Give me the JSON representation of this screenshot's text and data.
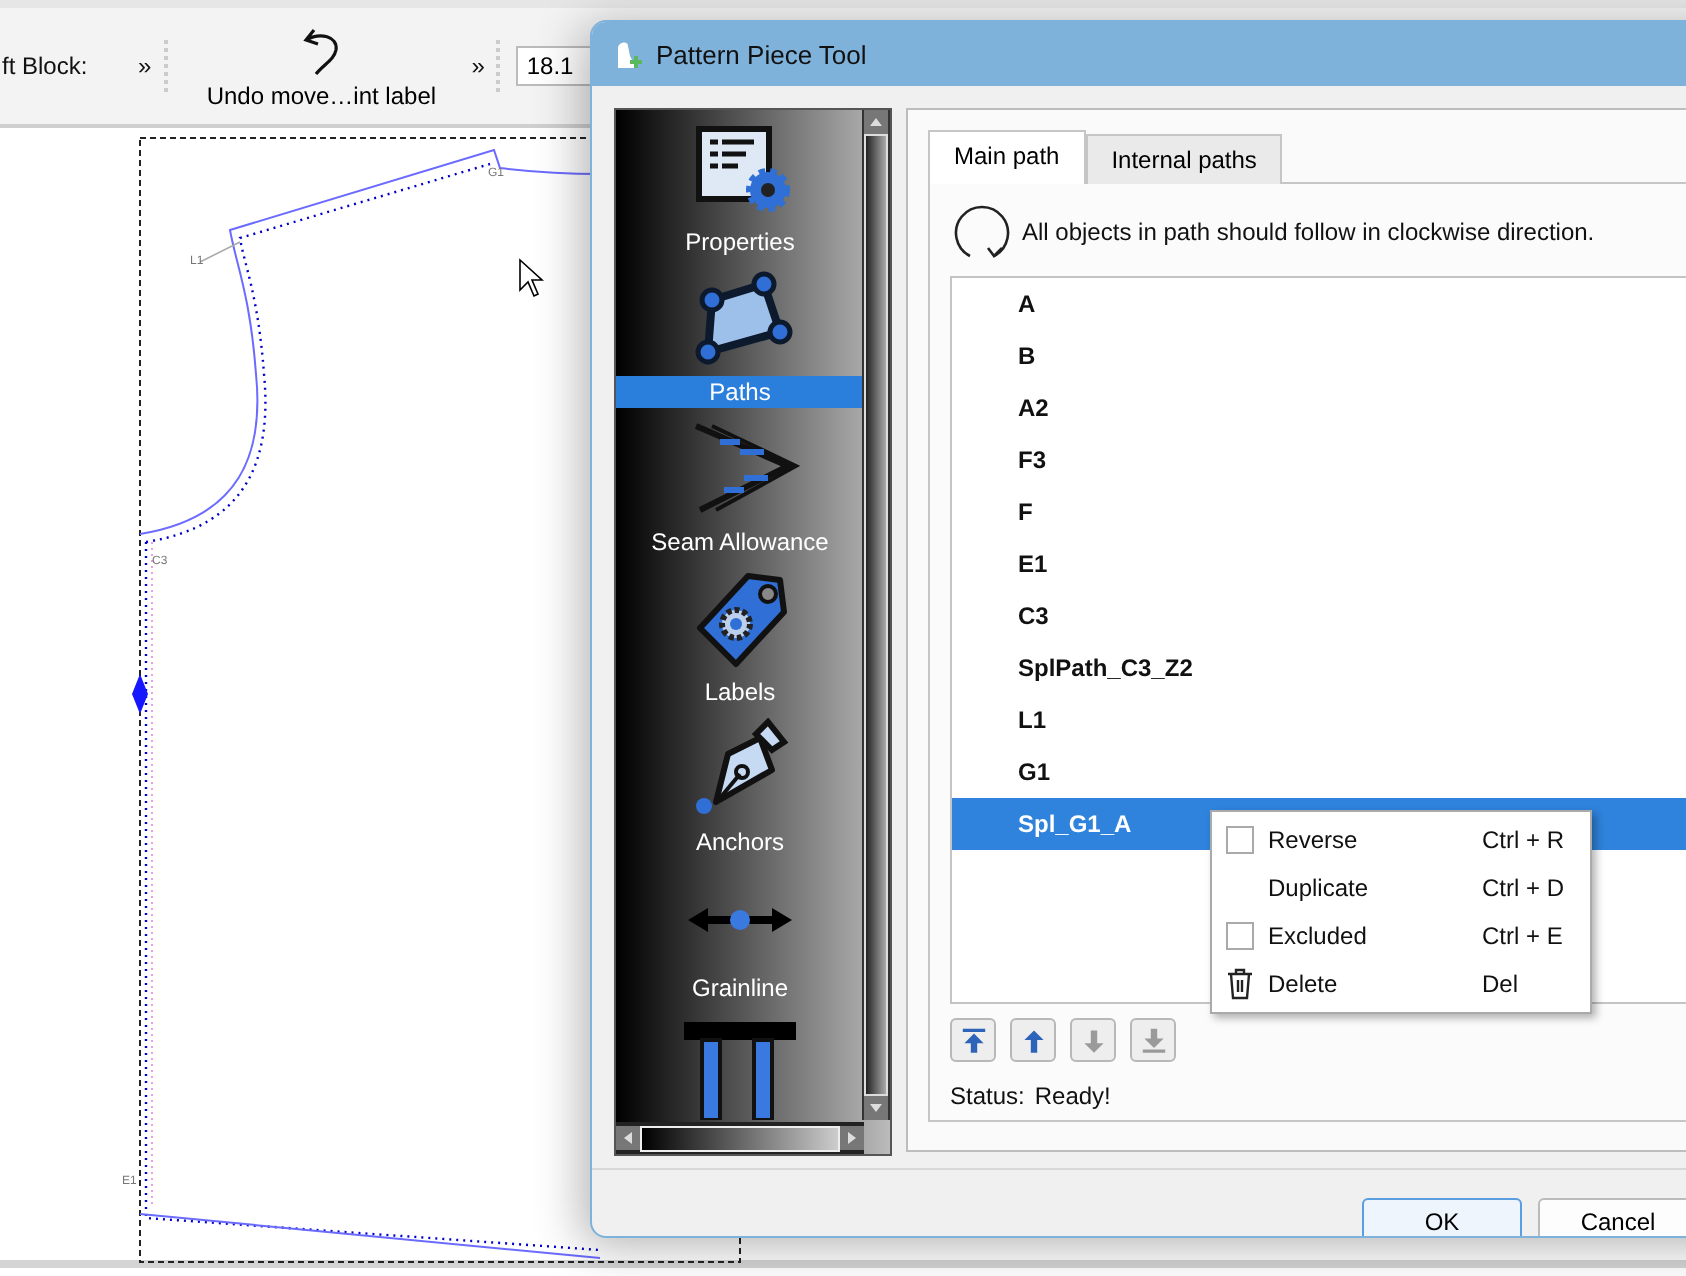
{
  "toolbar": {
    "block_label": "ft Block:",
    "chevrons": [
      "»",
      "»"
    ],
    "undo_label": "Undo move…int label",
    "field_value": "18.1"
  },
  "canvas": {
    "point_labels": [
      {
        "text": "G1",
        "kind": "top"
      },
      {
        "text": "L1",
        "kind": "shoulder"
      },
      {
        "text": "C3",
        "kind": "armhole"
      },
      {
        "text": "E1",
        "kind": "hem"
      }
    ]
  },
  "dialog": {
    "title": "Pattern Piece Tool",
    "sections": [
      {
        "label": "Properties",
        "kind": "properties",
        "selected": false
      },
      {
        "label": "Paths",
        "kind": "paths",
        "selected": true
      },
      {
        "label": "Seam Allowance",
        "kind": "seam",
        "selected": false
      },
      {
        "label": "Labels",
        "kind": "labels",
        "selected": false
      },
      {
        "label": "Anchors",
        "kind": "anchors",
        "selected": false
      },
      {
        "label": "Grainline",
        "kind": "grainline",
        "selected": false
      },
      {
        "kind": "table"
      }
    ],
    "tabs": [
      {
        "label": "Main path",
        "selected": true
      },
      {
        "label": "Internal paths",
        "selected": false
      }
    ],
    "hint": "All objects in path should follow in clockwise direction.",
    "path_items": [
      {
        "name": "A",
        "selected": false
      },
      {
        "name": "B",
        "selected": false
      },
      {
        "name": "A2",
        "selected": false
      },
      {
        "name": "F3",
        "selected": false
      },
      {
        "name": "F",
        "selected": false
      },
      {
        "name": "E1",
        "selected": false
      },
      {
        "name": "C3",
        "selected": false
      },
      {
        "name": "SplPath_C3_Z2",
        "selected": false
      },
      {
        "name": "L1",
        "selected": false
      },
      {
        "name": "G1",
        "selected": false
      },
      {
        "name": "Spl_G1_A",
        "selected": true
      }
    ],
    "context_menu": [
      {
        "label": "Reverse",
        "shortcut": "Ctrl + R",
        "kind": "checkbox",
        "checked": false
      },
      {
        "label": "Duplicate",
        "shortcut": "Ctrl + D",
        "kind": "plain"
      },
      {
        "label": "Excluded",
        "shortcut": "Ctrl + E",
        "kind": "checkbox",
        "checked": false
      },
      {
        "label": "Delete",
        "shortcut": "Del",
        "kind": "delete"
      }
    ],
    "move_buttons": [
      {
        "kind": "top",
        "disabled": false
      },
      {
        "kind": "up",
        "disabled": false
      },
      {
        "kind": "down",
        "disabled": true
      },
      {
        "kind": "bottom",
        "disabled": true
      }
    ],
    "status": {
      "label": "Status:",
      "value": "Ready!"
    },
    "buttons": [
      {
        "label": "OK",
        "default": true
      },
      {
        "label": "Cancel",
        "default": false
      }
    ]
  }
}
